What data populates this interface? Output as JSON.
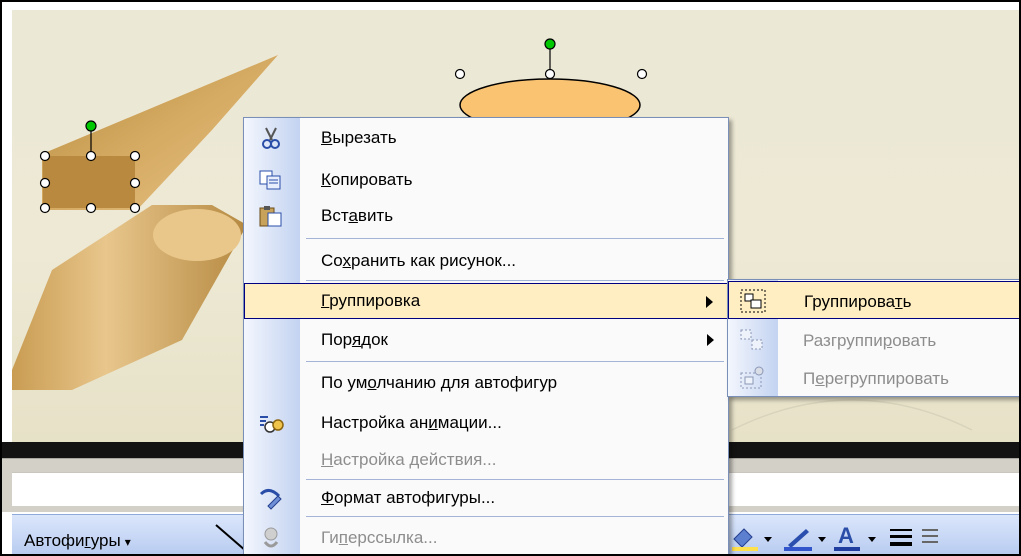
{
  "context_menu": {
    "items": [
      {
        "pre": "",
        "u": "В",
        "post": "ырезать",
        "enabled": true,
        "icon": "scissors-icon"
      },
      {
        "pre": "",
        "u": "К",
        "post": "опировать",
        "enabled": true,
        "icon": "copy-icon"
      },
      {
        "pre": "Вст",
        "u": "а",
        "post": "вить",
        "enabled": true,
        "icon": "paste-icon"
      },
      {
        "pre": "Со",
        "u": "х",
        "post": "ранить как рисунок...",
        "enabled": true,
        "icon": ""
      },
      {
        "pre": "",
        "u": "Г",
        "post": "руппировка",
        "enabled": true,
        "icon": "",
        "submenu": true,
        "highlighted": true
      },
      {
        "pre": "Пор",
        "u": "я",
        "post": "док",
        "enabled": true,
        "icon": "",
        "submenu": true
      },
      {
        "pre": "По ум",
        "u": "о",
        "post": "лчанию для автофигур",
        "enabled": true,
        "icon": ""
      },
      {
        "pre": "Настройка ан",
        "u": "и",
        "post": "мации...",
        "enabled": true,
        "icon": "animation-icon"
      },
      {
        "pre": "",
        "u": "Н",
        "post": "астройка действия...",
        "enabled": false,
        "icon": ""
      },
      {
        "pre": "",
        "u": "Ф",
        "post": "ормат автофигуры...",
        "enabled": true,
        "icon": "format-shape-icon"
      },
      {
        "pre": "Ги",
        "u": "п",
        "post": "ерссылка...",
        "enabled": false,
        "icon": "hyperlink-icon"
      }
    ]
  },
  "submenu": {
    "items": [
      {
        "pre": "Группирова",
        "u": "т",
        "post": "ь",
        "enabled": true,
        "icon": "group-icon"
      },
      {
        "pre": "Разгруппи",
        "u": "р",
        "post": "овать",
        "enabled": false,
        "icon": "ungroup-icon"
      },
      {
        "pre": "П",
        "u": "е",
        "post": "регруппировать",
        "enabled": false,
        "icon": "regroup-icon"
      }
    ]
  },
  "toolbar": {
    "autoshapes_pre": "Автофи",
    "autoshapes_u": "г",
    "autoshapes_post": "уры",
    "autoshapes_arrow": "▾"
  },
  "colors": {
    "menu_highlight": "#ffeec2",
    "menu_highlight_border": "#000080",
    "shape_fill": "#f9c372",
    "handle_green": "#00c800"
  }
}
